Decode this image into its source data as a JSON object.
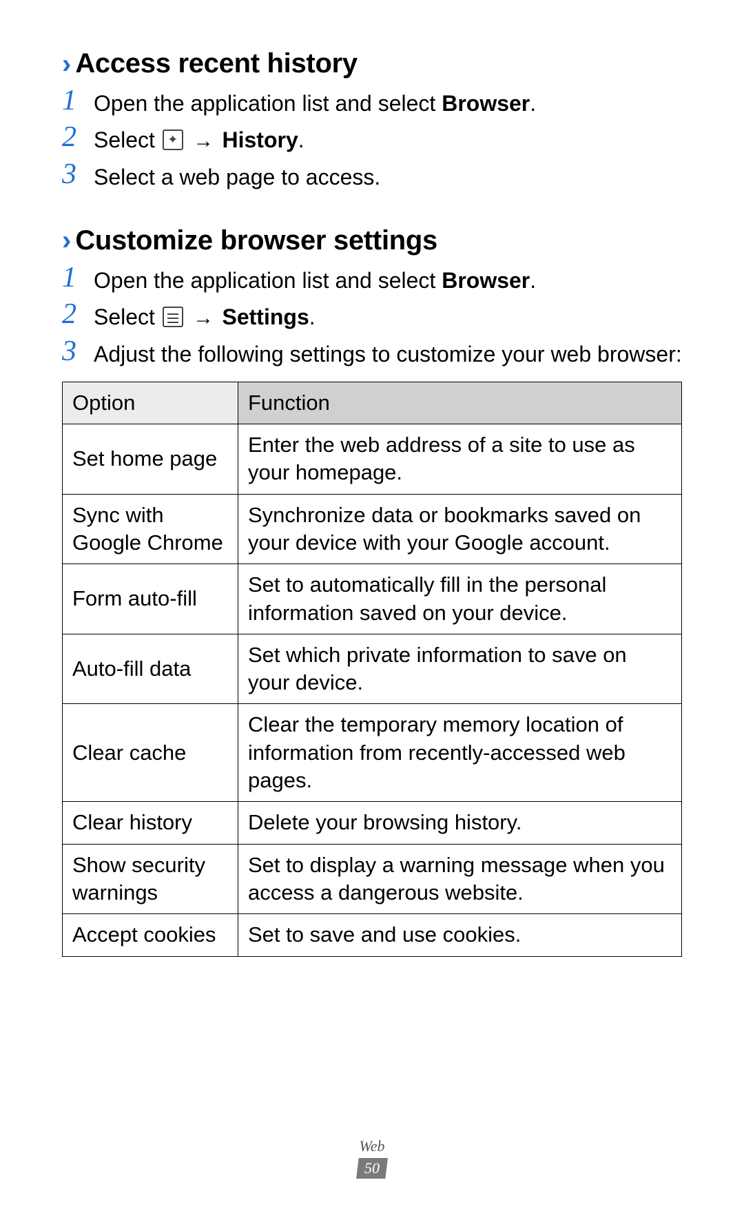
{
  "section1": {
    "heading": "Access recent history",
    "steps": [
      {
        "num": "1",
        "pre": "Open the application list and select ",
        "bold": "Browser",
        "post": "."
      },
      {
        "num": "2",
        "pre": "Select ",
        "icon": "star",
        "arrow": " → ",
        "bold": "History",
        "post": "."
      },
      {
        "num": "3",
        "pre": "Select a web page to access."
      }
    ]
  },
  "section2": {
    "heading": "Customize browser settings",
    "steps": [
      {
        "num": "1",
        "pre": "Open the application list and select ",
        "bold": "Browser",
        "post": "."
      },
      {
        "num": "2",
        "pre": "Select ",
        "icon": "menu",
        "arrow": " → ",
        "bold": "Settings",
        "post": "."
      },
      {
        "num": "3",
        "pre": "Adjust the following settings to customize your web browser:"
      }
    ]
  },
  "table": {
    "header": {
      "option": "Option",
      "function": "Function"
    },
    "rows": [
      {
        "option": "Set home page",
        "function": "Enter the web address of a site to use as your homepage."
      },
      {
        "option": "Sync with Google Chrome",
        "function": "Synchronize data or bookmarks saved on your device with your Google account."
      },
      {
        "option": "Form auto-fill",
        "function": "Set to automatically fill in the personal information saved on your device."
      },
      {
        "option": "Auto-fill data",
        "function": "Set which private information to save on your device."
      },
      {
        "option": "Clear cache",
        "function": "Clear the temporary memory location of information from recently-accessed web pages."
      },
      {
        "option": "Clear history",
        "function": "Delete your browsing history."
      },
      {
        "option": "Show security warnings",
        "function": "Set to display a warning message when you access a dangerous website."
      },
      {
        "option": "Accept cookies",
        "function": "Set to save and use cookies."
      }
    ]
  },
  "footer": {
    "label": "Web",
    "page": "50"
  }
}
